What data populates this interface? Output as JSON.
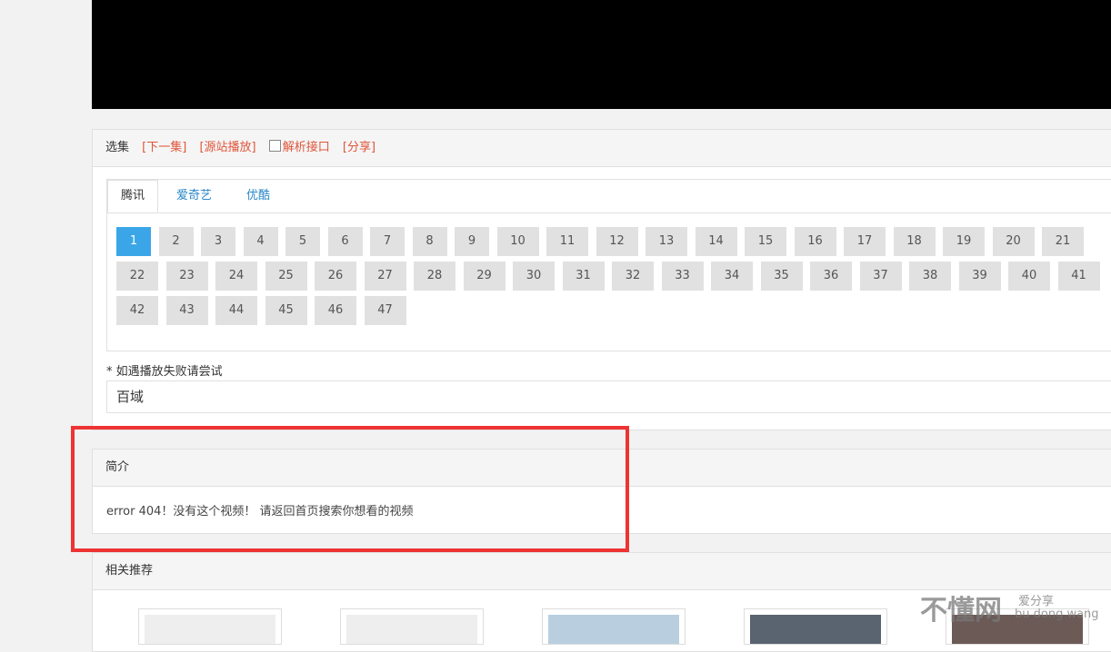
{
  "episodes_panel": {
    "title": "选集",
    "next_episode": "[下一集]",
    "source_play": "[源站播放]",
    "parse_api": "解析接口",
    "share": "[分享]"
  },
  "tabs": [
    {
      "label": "腾讯",
      "active": true
    },
    {
      "label": "爱奇艺",
      "active": false
    },
    {
      "label": "优酷",
      "active": false
    }
  ],
  "episodes": [
    "1",
    "2",
    "3",
    "4",
    "5",
    "6",
    "7",
    "8",
    "9",
    "10",
    "11",
    "12",
    "13",
    "14",
    "15",
    "16",
    "17",
    "18",
    "19",
    "20",
    "21",
    "22",
    "23",
    "24",
    "25",
    "26",
    "27",
    "28",
    "29",
    "30",
    "31",
    "32",
    "33",
    "34",
    "35",
    "36",
    "37",
    "38",
    "39",
    "40",
    "41",
    "42",
    "43",
    "44",
    "45",
    "46",
    "47"
  ],
  "active_episode": "1",
  "fallback": {
    "notice": "* 如遇播放失败请尝试",
    "selected": "百域"
  },
  "intro": {
    "title": "简介",
    "text": "error 404！没有这个视频！ 请返回首页搜索你想看的视频"
  },
  "related": {
    "title": "相关推荐"
  },
  "watermark": {
    "big": "不懂网",
    "small1": "爱分享",
    "small2": "bu dong wang"
  },
  "colors": {
    "accent_blue": "#3aa6e8",
    "link_red": "#e0553a",
    "highlight_red": "#ee3333"
  }
}
